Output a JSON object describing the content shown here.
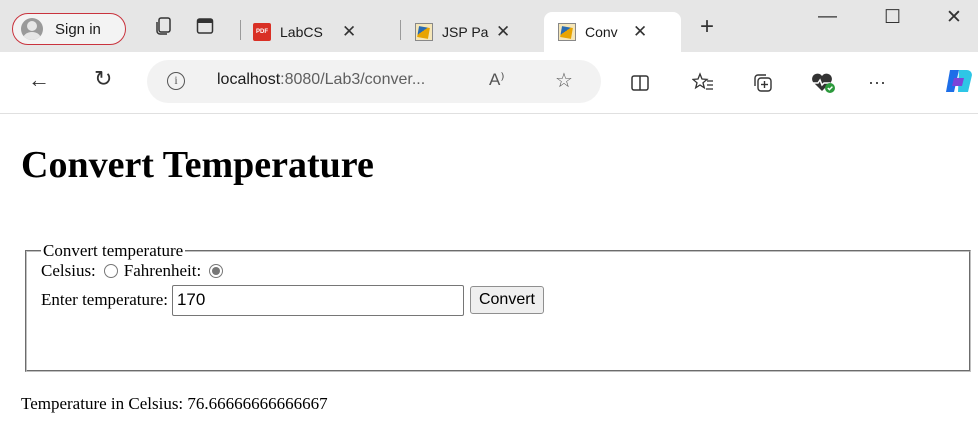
{
  "tabstrip": {
    "sign_in_label": "Sign in",
    "tabs": [
      {
        "title": "LabCS",
        "favicon": "pdf-icon",
        "favicon_text": "PDF"
      },
      {
        "title": "JSP Pa",
        "favicon": "jsp-icon"
      },
      {
        "title": "Conv",
        "favicon": "jsp-icon",
        "active": true
      }
    ],
    "close_glyph": "✕",
    "new_tab_glyph": "+",
    "window_controls": {
      "minimize": "—",
      "maximize": "☐",
      "close": "✕"
    }
  },
  "toolbar": {
    "back_glyph": "←",
    "reload_glyph": "↻",
    "address": {
      "host": "localhost",
      "rest": ":8080/Lab3/conver..."
    },
    "read_aloud_glyph": "A⁾",
    "favorite_glyph": "☆",
    "icons": [
      "split-screen-icon",
      "favorites-icon",
      "collections-icon",
      "browser-essentials-icon",
      "more-icon",
      "copilot-icon"
    ],
    "more_glyph": "···"
  },
  "page": {
    "heading": "Convert Temperature",
    "legend": "Convert temperature",
    "celsius_label": "Celsius:",
    "fahrenheit_label": "Fahrenheit:",
    "selected_unit": "fahrenheit",
    "temperature_label": "Enter temperature:",
    "temperature_value": "170",
    "convert_button": "Convert",
    "result": "Temperature in Celsius: 76.66666666666667"
  },
  "colors": {
    "tabstrip_bg": "#e6e6e6",
    "sign_in_border": "#c9333d",
    "address_bg": "#f2f2f2"
  }
}
